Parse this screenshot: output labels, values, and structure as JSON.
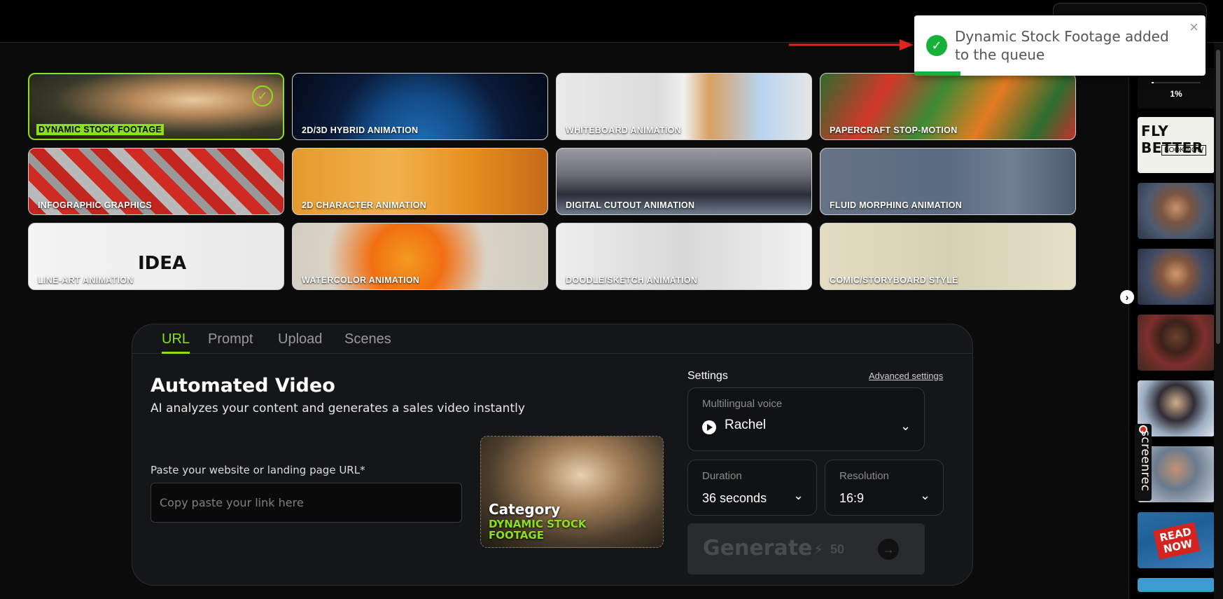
{
  "toast": {
    "message": "Dynamic Stock Footage added to the queue",
    "close": "×",
    "icon": "check-circle-icon",
    "color": "#17b139"
  },
  "styles": [
    {
      "label": "DYNAMIC STOCK FOOTAGE",
      "selected": true
    },
    {
      "label": "2D/3D HYBRID ANIMATION",
      "selected": false
    },
    {
      "label": "WHITEBOARD ANIMATION",
      "selected": false
    },
    {
      "label": "PAPERCRAFT STOP-MOTION",
      "selected": false
    },
    {
      "label": "INFOGRAPHIC GRAPHICS",
      "selected": false
    },
    {
      "label": "2D CHARACTER ANIMATION",
      "selected": false
    },
    {
      "label": "DIGITAL CUTOUT ANIMATION",
      "selected": false
    },
    {
      "label": "FLUID MORPHING ANIMATION",
      "selected": false
    },
    {
      "label": "LINE-ART ANIMATION",
      "selected": false
    },
    {
      "label": "WATERCOLOR ANIMATION",
      "selected": false
    },
    {
      "label": "DOODLE/SKETCH ANIMATION",
      "selected": false
    },
    {
      "label": "COMIC/STORYBOARD STYLE",
      "selected": false
    }
  ],
  "card_text": {
    "idea": "IDEA"
  },
  "tabs": [
    "URL",
    "Prompt",
    "Upload",
    "Scenes"
  ],
  "active_tab": "URL",
  "main": {
    "title": "Automated Video",
    "subtitle": "AI analyzes your content and generates a sales video instantly",
    "url_label": "Paste your website or landing page URL*",
    "url_placeholder": "Copy paste your link here",
    "url_value": ""
  },
  "category": {
    "title": "Category",
    "value": "DYNAMIC STOCK FOOTAGE"
  },
  "settings": {
    "label": "Settings",
    "advanced": "Advanced settings",
    "voice_label": "Multilingual voice",
    "voice_value": "Rachel",
    "duration_label": "Duration",
    "duration_value": "36 seconds",
    "resolution_label": "Resolution",
    "resolution_value": "16:9"
  },
  "generate": {
    "label": "Generate",
    "cost": "50",
    "enabled": false
  },
  "sidebar": {
    "progress": "1%",
    "progress_value": 0.01,
    "fly_title": "FLY BETTER",
    "fly_sub": "BOOK NOW",
    "read_badge": "READ NOW",
    "screenrec": "screenrec"
  },
  "colors": {
    "accent": "#8be01a",
    "background": "#0b0b0b",
    "panel": "#151618"
  }
}
